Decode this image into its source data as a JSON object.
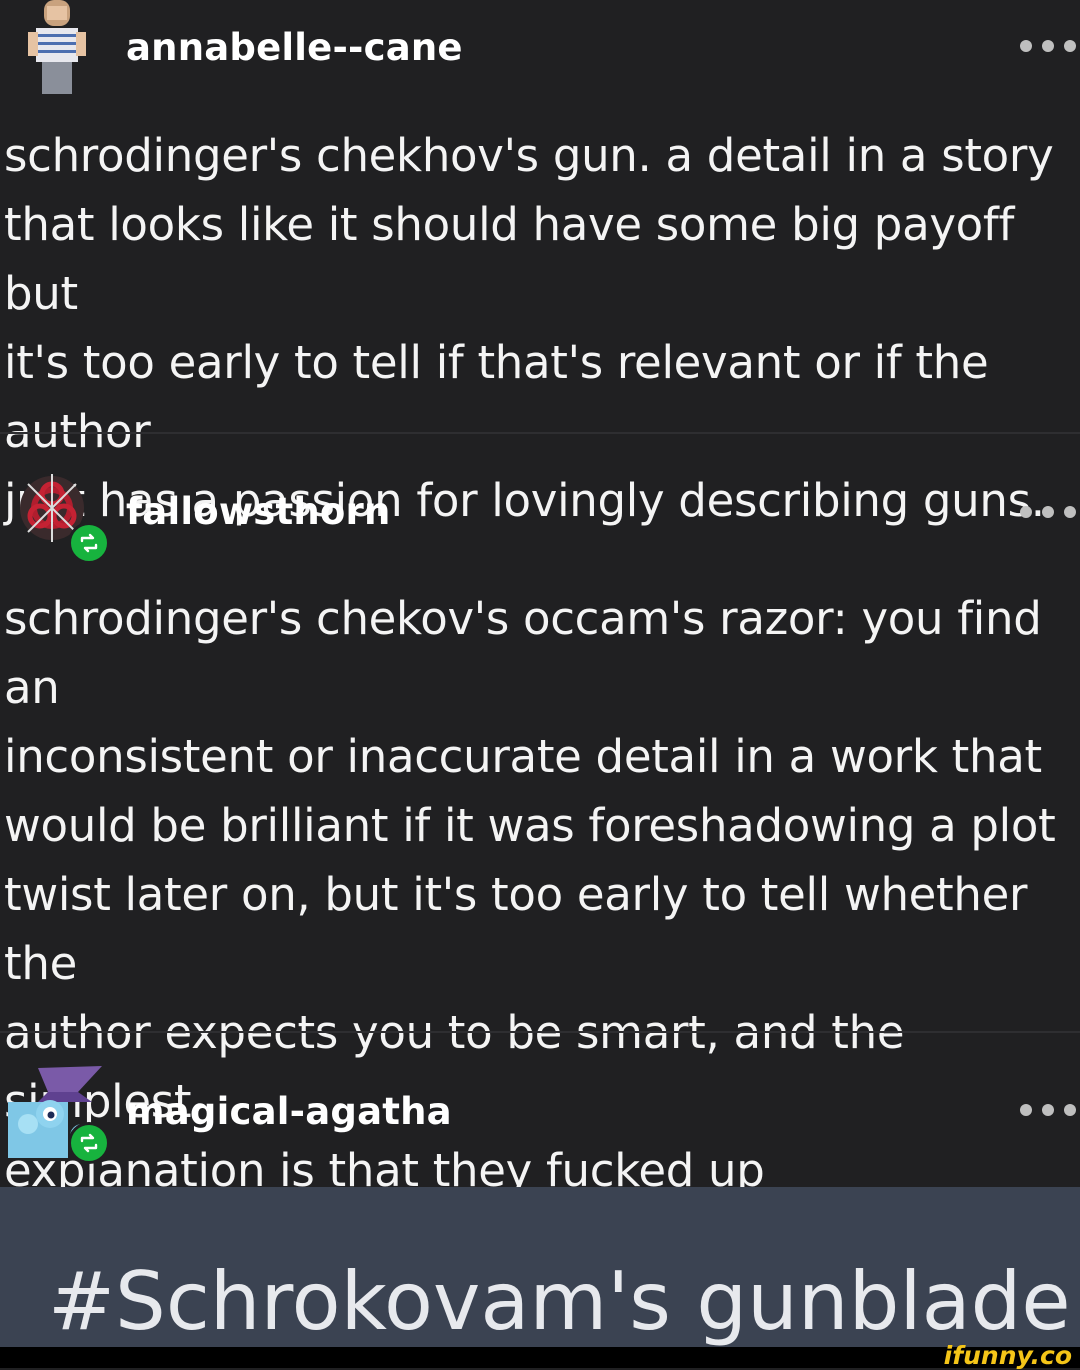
{
  "posts": [
    {
      "username": "annabelle--cane",
      "lines": [
        "schrodinger's chekhov's gun. a detail in a story",
        "that looks like it should have some big payoff but",
        "it's too early to tell if that's relevant or if the author",
        "just has a passion for lovingly describing guns."
      ]
    },
    {
      "username": "fallowsthorn",
      "lines": [
        "schrodinger's chekov's occam's razor: you find an",
        "inconsistent or inaccurate detail in a work that",
        "would be brilliant if it was foreshadowing a plot",
        "twist later on, but it's too early to tell whether the",
        "author expects you to be smart, and the simplest",
        "explanation is that they fucked up"
      ]
    },
    {
      "username": "magical-agatha",
      "tag": "#Schrokovam's gunblade"
    }
  ],
  "watermark": "ifunny.co",
  "colors": {
    "background": "#202022",
    "reblog_badge": "#17b33e",
    "tag_bar": "#3b4352",
    "watermark": "#f5c518"
  },
  "icons": [
    "user-avatar",
    "reblog-icon",
    "more-options-icon"
  ]
}
